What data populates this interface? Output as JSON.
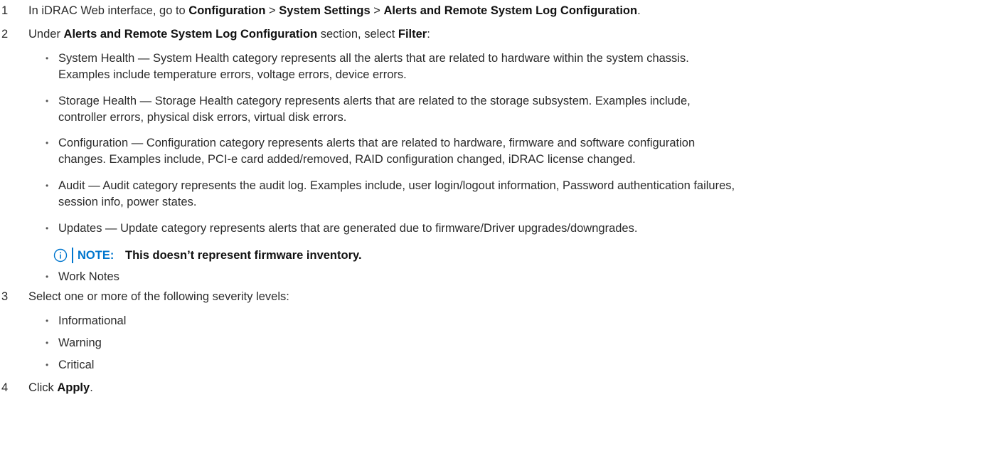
{
  "steps": [
    {
      "num": "1",
      "parts": [
        "In iDRAC Web interface, go to ",
        "Configuration",
        " > ",
        "System Settings",
        " > ",
        "Alerts and Remote System Log Configuration",
        "."
      ]
    },
    {
      "num": "2",
      "parts": [
        "Under ",
        "Alerts and Remote System Log Configuration",
        " section, select ",
        "Filter",
        ":"
      ]
    },
    {
      "num": "3",
      "text": "Select one or more of the following severity levels:"
    },
    {
      "num": "4",
      "parts": [
        "Click ",
        "Apply",
        "."
      ]
    }
  ],
  "filter_items": [
    {
      "lines": [
        "System Health — System Health category represents all the alerts that are related to hardware within the system chassis.",
        "Examples include temperature errors, voltage errors, device errors."
      ]
    },
    {
      "lines": [
        "Storage Health — Storage Health category represents alerts that are related to the storage subsystem. Examples include,",
        "controller errors, physical disk errors, virtual disk errors."
      ]
    },
    {
      "lines": [
        "Configuration — Configuration category represents alerts that are related to hardware, firmware and software configuration",
        "changes. Examples include, PCI-e card added/removed, RAID configuration changed, iDRAC license changed."
      ]
    },
    {
      "lines": [
        "Audit — Audit category represents the audit log. Examples include, user login/logout information, Password authentication failures,",
        "session info, power states."
      ]
    },
    {
      "lines": [
        "Updates — Update category represents alerts that are generated due to firmware/Driver upgrades/downgrades."
      ]
    }
  ],
  "note": {
    "label": "NOTE:",
    "text": "This doesn’t represent firmware inventory."
  },
  "work_notes": "Work Notes",
  "severity_levels": [
    "Informational",
    "Warning",
    "Critical"
  ],
  "bullet_char": "•",
  "colors": {
    "note_accent": "#0076ce",
    "body_text": "#2b2b2b"
  },
  "icons": {
    "note": "info-icon"
  }
}
